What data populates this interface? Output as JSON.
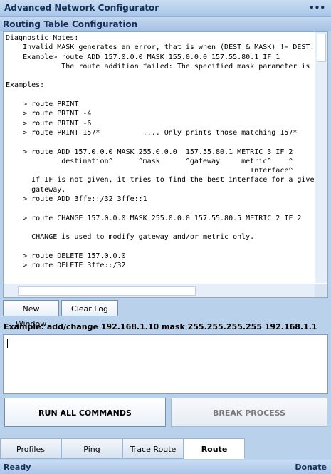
{
  "window": {
    "title": "Advanced Network Configurator",
    "menu_glyph": "•••"
  },
  "section": {
    "title": "Routing Table Configuration"
  },
  "output": {
    "text": "Diagnostic Notes:\n    Invalid MASK generates an error, that is when (DEST & MASK) != DEST.\n    Example> route ADD 157.0.0.0 MASK 155.0.0.0 157.55.80.1 IF 1\n             The route addition failed: The specified mask parameter is :\n\nExamples:\n\n    > route PRINT\n    > route PRINT -4\n    > route PRINT -6\n    > route PRINT 157*          .... Only prints those matching 157*\n\n    > route ADD 157.0.0.0 MASK 255.0.0.0  157.55.80.1 METRIC 3 IF 2\n             destination^      ^mask      ^gateway     metric^    ^\n                                                         Interface^\n      If IF is not given, it tries to find the best interface for a given\n      gateway.\n    > route ADD 3ffe::/32 3ffe::1\n\n    > route CHANGE 157.0.0.0 MASK 255.0.0.0 157.55.80.5 METRIC 2 IF 2\n\n      CHANGE is used to modify gateway and/or metric only.\n\n    > route DELETE 157.0.0.0\n    > route DELETE 3ffe::/32"
  },
  "buttons": {
    "new_window": "New Window",
    "clear_log": "Clear Log",
    "run_all": "RUN ALL COMMANDS",
    "break_process": "BREAK PROCESS"
  },
  "example_label": "Example: add/change 192.168.1.10 mask 255.255.255.255 192.168.1.1",
  "command_input": {
    "value": ""
  },
  "tabs": [
    {
      "label": "Profiles",
      "active": false
    },
    {
      "label": "Ping",
      "active": false
    },
    {
      "label": "Trace Route",
      "active": false
    },
    {
      "label": "Route",
      "active": true
    }
  ],
  "status": {
    "text": "Ready",
    "donate": "Donate"
  },
  "colors": {
    "accent": "#14305a",
    "chrome": "#b9d1ea",
    "border": "#6f8fb8"
  }
}
